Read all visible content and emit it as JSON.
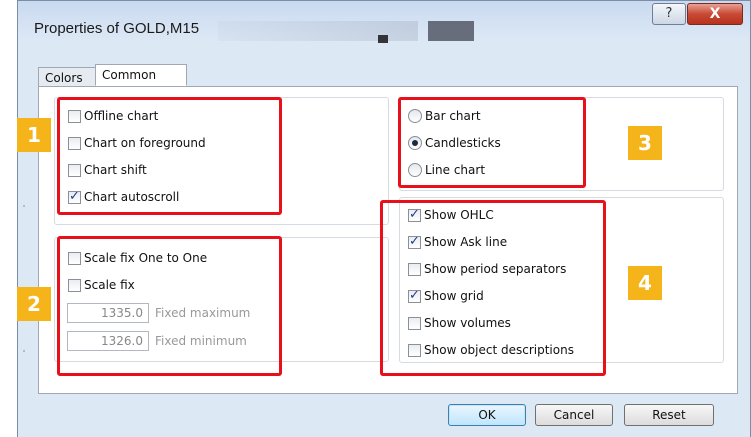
{
  "window": {
    "title": "Properties of GOLD,M15",
    "help_label": "?",
    "close_label": "X"
  },
  "tabs": [
    {
      "label": "Colors",
      "active": false
    },
    {
      "label": "Common",
      "active": true
    }
  ],
  "group1": {
    "items": [
      {
        "label": "Offline chart",
        "checked": false
      },
      {
        "label": "Chart on foreground",
        "checked": false
      },
      {
        "label": "Chart shift",
        "checked": false
      },
      {
        "label": "Chart autoscroll",
        "checked": true
      }
    ]
  },
  "group2": {
    "items": [
      {
        "label": "Scale fix One to One",
        "checked": false
      },
      {
        "label": "Scale fix",
        "checked": false
      }
    ],
    "fixed_maximum": {
      "value": "1335.0",
      "label": "Fixed maximum"
    },
    "fixed_minimum": {
      "value": "1326.0",
      "label": "Fixed minimum"
    }
  },
  "chart_type": {
    "options": [
      {
        "label": "Bar chart",
        "selected": false
      },
      {
        "label": "Candlesticks",
        "selected": true
      },
      {
        "label": "Line chart",
        "selected": false
      }
    ]
  },
  "display": {
    "items": [
      {
        "label": "Show OHLC",
        "checked": true
      },
      {
        "label": "Show Ask line",
        "checked": true
      },
      {
        "label": "Show period separators",
        "checked": false
      },
      {
        "label": "Show grid",
        "checked": true
      },
      {
        "label": "Show volumes",
        "checked": false
      },
      {
        "label": "Show object descriptions",
        "checked": false
      }
    ]
  },
  "markers": [
    "1",
    "2",
    "3",
    "4"
  ],
  "buttons": {
    "ok": "OK",
    "cancel": "Cancel",
    "reset": "Reset"
  },
  "colors": {
    "highlight_red": "#e8101a",
    "marker_orange": "#f4b41a"
  }
}
